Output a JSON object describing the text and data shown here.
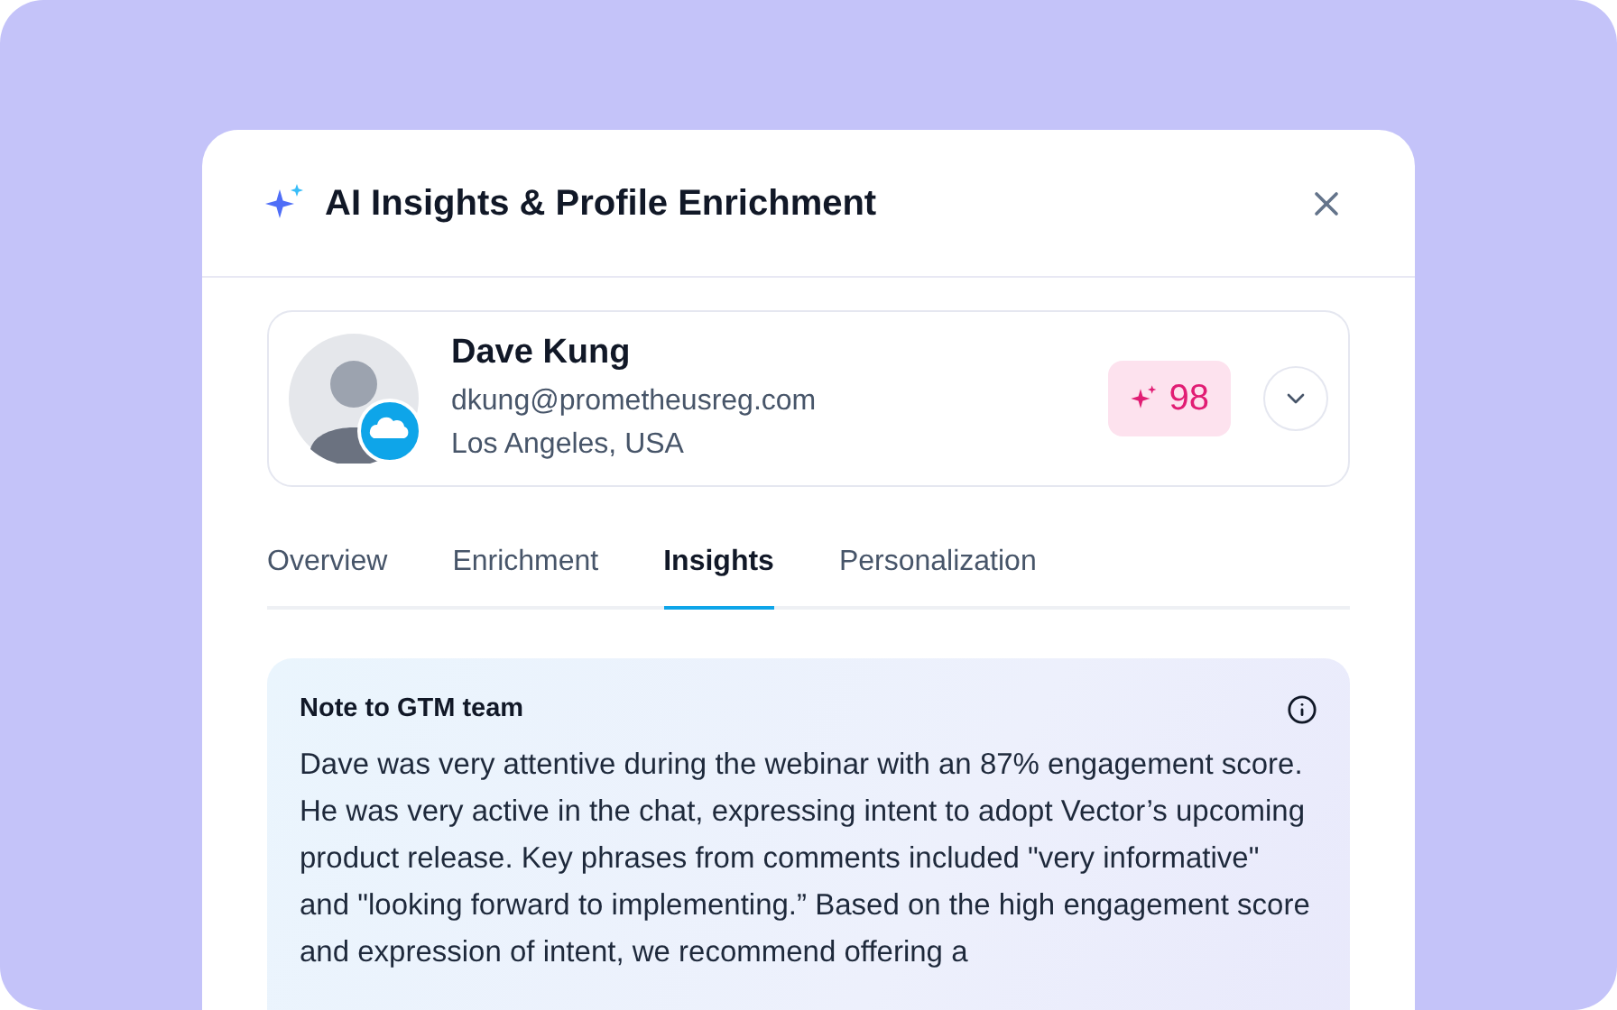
{
  "dialog": {
    "title": "AI Insights & Profile Enrichment"
  },
  "profile": {
    "name": "Dave Kung",
    "email": "dkung@prometheusreg.com",
    "location": "Los Angeles, USA",
    "score": "98",
    "expanded": false
  },
  "tabs": [
    {
      "label": "Overview",
      "selected": false
    },
    {
      "label": "Enrichment",
      "selected": false
    },
    {
      "label": "Insights",
      "selected": true
    },
    {
      "label": "Personalization",
      "selected": false
    }
  ],
  "note": {
    "title": "Note to GTM team",
    "body": "Dave was very attentive during the webinar with an 87% engagement score. He was very active in the chat, expressing intent to adopt Vector’s upcoming product release. Key phrases from comments included \"very informative\" and \"looking forward to implementing.” Based on the high engagement score and expression of intent, we recommend offering a"
  }
}
